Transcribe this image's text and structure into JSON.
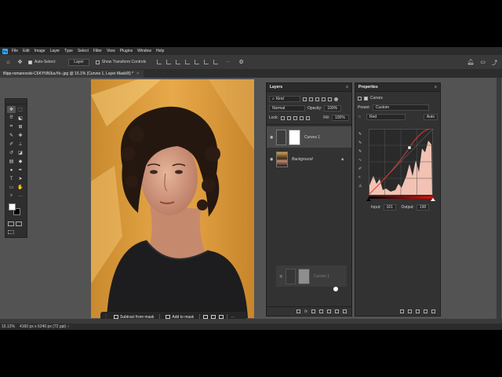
{
  "menubar": {
    "logo": "Ps",
    "items": [
      "File",
      "Edit",
      "Image",
      "Layer",
      "Type",
      "Select",
      "Filter",
      "View",
      "Plugins",
      "Window",
      "Help"
    ]
  },
  "optionsbar": {
    "auto_select_label": "Auto-Select:",
    "auto_select_target": "Layer",
    "show_transform_label": "Show Transform Controls",
    "more_label": "···"
  },
  "document": {
    "tab_title": "filipp-romanovski-C6KYNN3uuYo-.jpg @ 15.1% (Curves 1, Layer Mask/8) *",
    "close": "×"
  },
  "taskbar": {
    "subtract_label": "Subtract from mask",
    "add_label": "Add to mask"
  },
  "layers_panel": {
    "title": "Layers",
    "filter_kind": "Kind",
    "blend_mode": "Normal",
    "opacity_label": "Opacity:",
    "opacity_value": "100%",
    "lock_label": "Lock:",
    "fill_label": "Fill:",
    "fill_value": "100%",
    "layers": [
      {
        "name": "Curves 1"
      },
      {
        "name": "Background"
      }
    ],
    "drag_ghost_name": "Curves 1"
  },
  "properties_panel": {
    "title": "Properties",
    "subtitle": "Curves",
    "preset_label": "Preset:",
    "preset_value": "Custom",
    "channel_value": "Red",
    "auto_label": "Auto",
    "input_label": "Input:",
    "input_value": "161",
    "output_label": "Output:",
    "output_value": "190"
  },
  "statusbar": {
    "zoom": "15.12%",
    "dimensions": "4160 px x 6240 px (72 ppi)"
  },
  "colors": {
    "accent": "#31a8ff",
    "panel_bg": "#323232",
    "workspace_bg": "#535353",
    "curve_red": "#e03a3a",
    "histogram_fill": "#f2c2b4"
  }
}
